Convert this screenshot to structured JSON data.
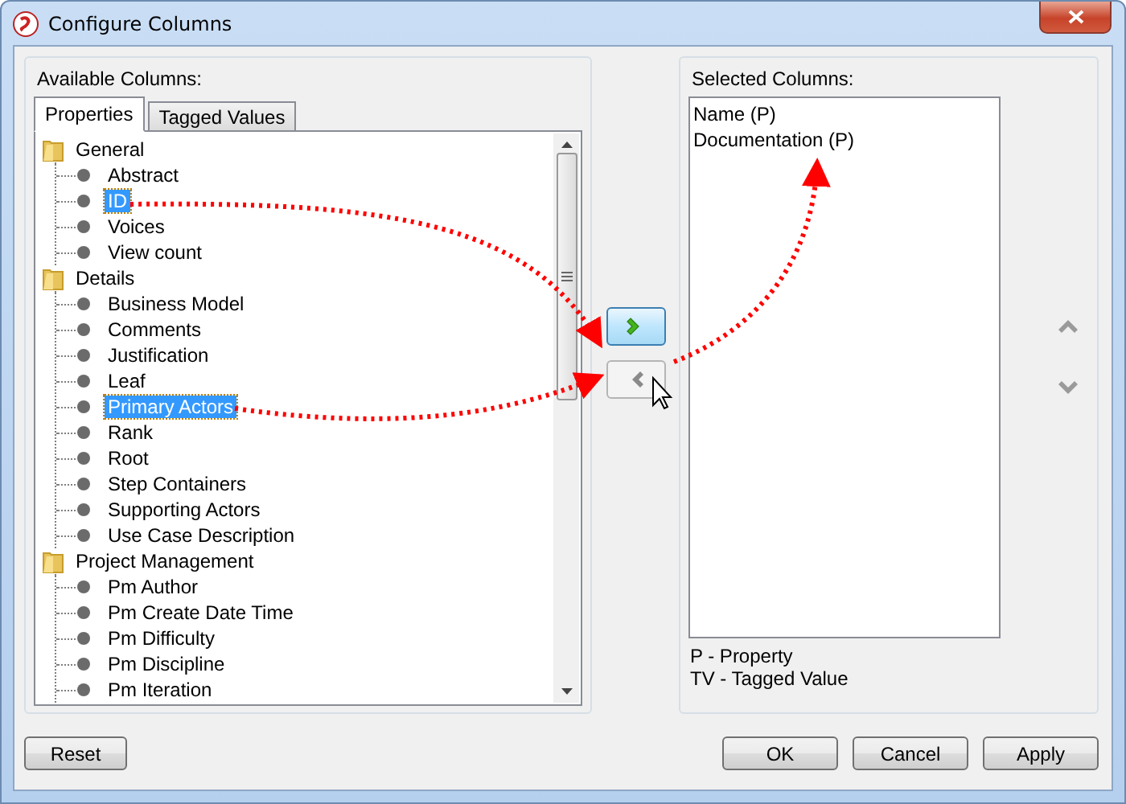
{
  "window": {
    "title": "Configure Columns"
  },
  "available": {
    "label": "Available Columns:",
    "tabs": [
      {
        "label": "Properties",
        "selected": true
      },
      {
        "label": "Tagged Values",
        "selected": false
      }
    ],
    "tree": [
      {
        "label": "General",
        "expanded": true,
        "children": [
          {
            "label": "Abstract",
            "selected": false
          },
          {
            "label": "ID",
            "selected": true
          },
          {
            "label": "Voices",
            "selected": false
          },
          {
            "label": "View count",
            "selected": false
          }
        ]
      },
      {
        "label": "Details",
        "expanded": true,
        "children": [
          {
            "label": "Business Model",
            "selected": false
          },
          {
            "label": "Comments",
            "selected": false
          },
          {
            "label": "Justification",
            "selected": false
          },
          {
            "label": "Leaf",
            "selected": false
          },
          {
            "label": "Primary Actors",
            "selected": true
          },
          {
            "label": "Rank",
            "selected": false
          },
          {
            "label": "Root",
            "selected": false
          },
          {
            "label": "Step Containers",
            "selected": false
          },
          {
            "label": "Supporting Actors",
            "selected": false
          },
          {
            "label": "Use Case Description",
            "selected": false
          }
        ]
      },
      {
        "label": "Project Management",
        "expanded": true,
        "children": [
          {
            "label": "Pm Author",
            "selected": false
          },
          {
            "label": "Pm Create Date Time",
            "selected": false
          },
          {
            "label": "Pm Difficulty",
            "selected": false
          },
          {
            "label": "Pm Discipline",
            "selected": false
          },
          {
            "label": "Pm Iteration",
            "selected": false
          }
        ]
      }
    ]
  },
  "transfer_buttons": [
    {
      "kind": "add",
      "disabled": false,
      "hovered": true
    },
    {
      "kind": "remove",
      "disabled": true,
      "hovered": false
    }
  ],
  "selected": {
    "label": "Selected Columns:",
    "items": [
      {
        "label": "Name (P)"
      },
      {
        "label": "Documentation (P)"
      }
    ],
    "legend": [
      "P - Property",
      "TV - Tagged Value"
    ]
  },
  "reorder_buttons": [
    {
      "kind": "up"
    },
    {
      "kind": "down"
    }
  ],
  "buttons": [
    {
      "label": "Reset",
      "kind": "left"
    },
    {
      "label": "OK",
      "kind": "right"
    },
    {
      "label": "Cancel",
      "kind": "right"
    },
    {
      "label": "Apply",
      "kind": "right"
    }
  ]
}
